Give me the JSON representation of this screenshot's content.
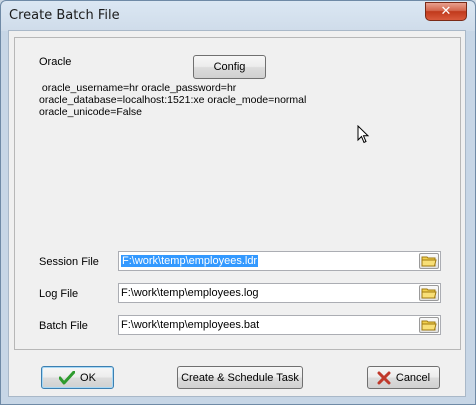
{
  "window": {
    "title": "Create Batch File",
    "close_glyph": "✕"
  },
  "oracle": {
    "label": "Oracle",
    "config_label": "Config",
    "info_lines": [
      " oracle_username=hr oracle_password=hr",
      "oracle_database=localhost:1521:xe oracle_mode=normal",
      "oracle_unicode=False"
    ]
  },
  "files": {
    "session": {
      "label": "Session File",
      "value": "F:\\work\\temp\\employees.ldr"
    },
    "log": {
      "label": "Log File",
      "value": "F:\\work\\temp\\employees.log"
    },
    "batch": {
      "label": "Batch File",
      "value": "F:\\work\\temp\\employees.bat"
    }
  },
  "buttons": {
    "ok": "OK",
    "schedule": "Create & Schedule Task",
    "cancel": "Cancel"
  },
  "colors": {
    "ok_check": "#2e9b2e",
    "cancel_x": "#c0392b",
    "selection": "#3399ff"
  }
}
